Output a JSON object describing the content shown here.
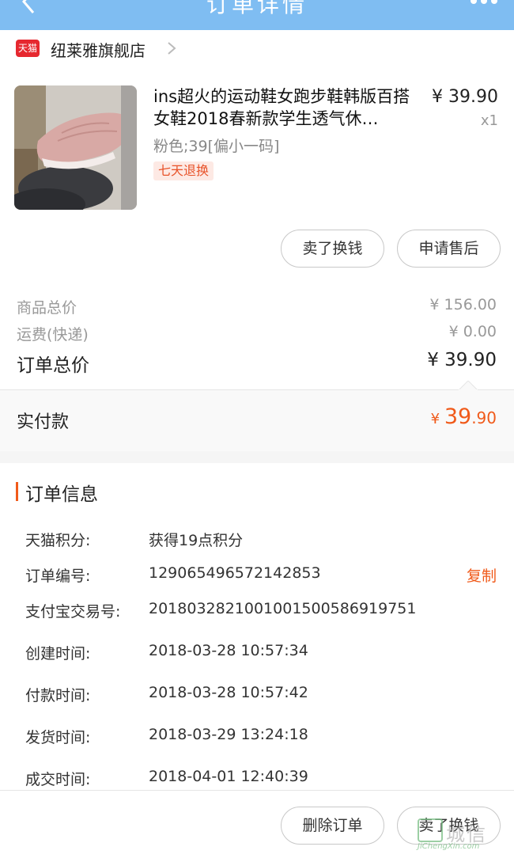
{
  "navbar": {
    "title": "订单详情"
  },
  "shop": {
    "badge": "天猫",
    "name": "纽莱雅旗舰店"
  },
  "product": {
    "title": "ins超火的运动鞋女跑步鞋韩版百搭女鞋2018春新款学生透气休…",
    "spec": "粉色;39[偏小一码]",
    "tag": "七天退换",
    "price": "¥ 39.90",
    "qty": "x1"
  },
  "actions": {
    "sell": "卖了换钱",
    "after_sale": "申请售后"
  },
  "costs": {
    "goods_label": "商品总价",
    "goods_value": "¥ 156.00",
    "shipping_label": "运费(快递)",
    "shipping_value": "¥ 0.00",
    "total_label": "订单总价",
    "total_value": "¥ 39.90"
  },
  "paid": {
    "label": "实付款",
    "currency": "¥ ",
    "integer": "39",
    "decimal": ".90"
  },
  "order_info": {
    "heading": "订单信息",
    "copy_label": "复制",
    "rows": [
      {
        "key": "天猫积分:",
        "value": "获得19点积分"
      },
      {
        "key": "订单编号:",
        "value": "129065496572142853"
      },
      {
        "key": "支付宝交易号:",
        "value": "2018032821001001500586919751"
      },
      {
        "key": "创建时间:",
        "value": "2018-03-28 10:57:34"
      },
      {
        "key": "付款时间:",
        "value": "2018-03-28 10:57:42"
      },
      {
        "key": "发货时间:",
        "value": "2018-03-29 13:24:18"
      },
      {
        "key": "成交时间:",
        "value": "2018-04-01 12:40:39"
      }
    ]
  },
  "footer": {
    "delete": "删除订单",
    "sell": "卖了换钱"
  },
  "watermark": {
    "text": "城信",
    "url": "JiChengXin.com"
  },
  "colors": {
    "navbar": "#7fbdf2",
    "accent": "#f05a1a",
    "tmall_red": "#e6282f"
  }
}
